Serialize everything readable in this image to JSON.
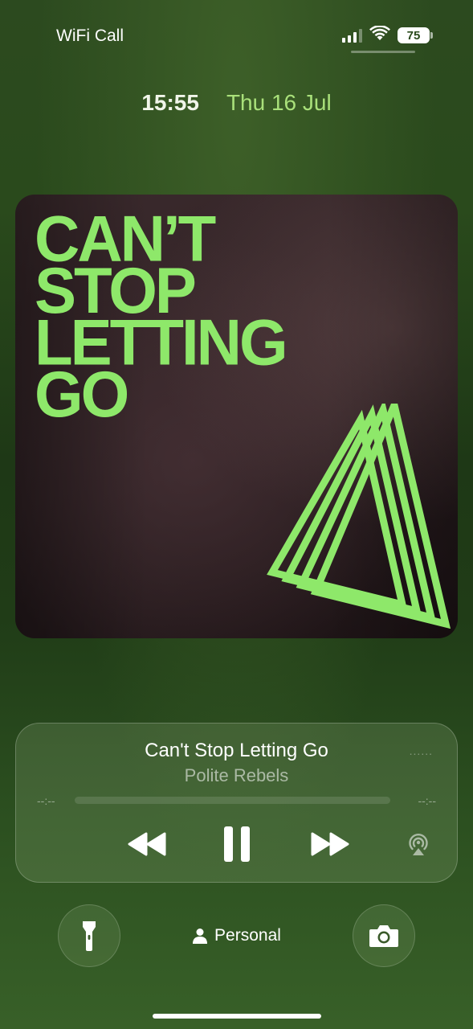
{
  "status_bar": {
    "carrier": "WiFi Call",
    "battery_level": "75",
    "signal_bars": 3,
    "icons": [
      "signal-icon",
      "wifi-icon",
      "battery-icon"
    ]
  },
  "lock_screen": {
    "time": "15:55",
    "date": "Thu 16 Jul",
    "date_color": "#a9e07a"
  },
  "artwork": {
    "title_lines": [
      "CAN’T",
      "STOP",
      "LETTING",
      "GO"
    ],
    "accent_color": "#8ee86a"
  },
  "now_playing": {
    "title": "Can't Stop Letting Go",
    "artist": "Polite Rebels",
    "elapsed": "--:--",
    "remaining": "--:--",
    "progress": 0,
    "menu": "......",
    "controls": [
      "rewind-icon",
      "pause-icon",
      "fast-forward-icon",
      "airplay-icon"
    ]
  },
  "bottom": {
    "focus_label": "Personal",
    "left_button": "flashlight-icon",
    "right_button": "camera-icon"
  }
}
